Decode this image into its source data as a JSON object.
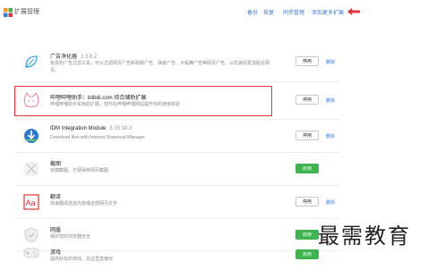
{
  "header": {
    "title": "扩展管理",
    "links": [
      "备份",
      "恢复",
      "同步管理",
      "添加更多扩展"
    ]
  },
  "extensions": [
    {
      "name": "广告净化器",
      "version": "2.3.6.2",
      "desc": "免费的广告过滤工具，可以过滤网页广告和视频广告、弹窗广告、大幅横广告等网页广告，以优速而更加贴近网页。",
      "button": "停用",
      "remove": "删除"
    },
    {
      "name": "哔哩哔哩助手：bilibili.com 综合辅助扩展",
      "version": "",
      "desc": "哔哩哔哩助手实用的扩展，帮你在哔哩哔哩网站提升你的使用体验",
      "button": "停用",
      "remove": "删除"
    },
    {
      "name": "IDM Integration Module",
      "version": "6.35.18.3",
      "desc": "Download files with Internet Download Manager",
      "button": "停用",
      "remove": "删除"
    },
    {
      "name": "截图",
      "version": "",
      "desc": "快捷截图、方便保存网页截图",
      "button": "启用",
      "remove": ""
    },
    {
      "name": "翻译",
      "version": "",
      "desc": "快速翻译选定内容或全部网页文字",
      "button": "停用",
      "remove": "删除"
    },
    {
      "name": "网盾",
      "version": "",
      "desc": "保护您的浏览器安全",
      "button": "启用",
      "remove": ""
    },
    {
      "name": "游戏",
      "version": "",
      "desc": "提供好玩的游戏、在这里直接玩",
      "button": "启用",
      "remove": ""
    }
  ],
  "watermark": "最需教育",
  "colors": {
    "link": "#3b7ad1",
    "enable_green": "#3fb34f",
    "highlight_red": "#e0333a"
  }
}
